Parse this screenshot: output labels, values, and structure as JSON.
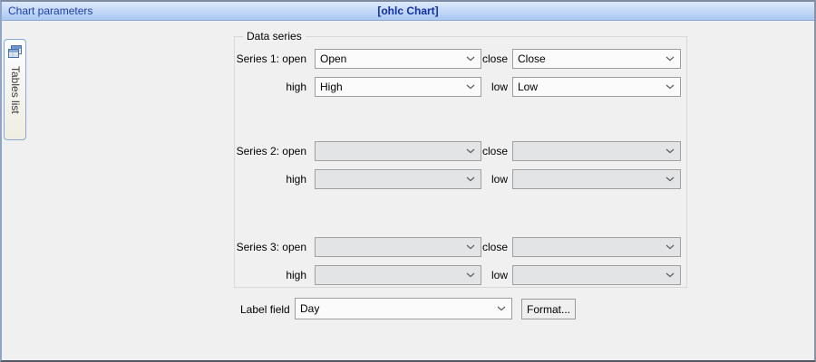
{
  "window": {
    "header": {
      "title_left": "Chart parameters",
      "title_center": "[ohlc Chart]"
    }
  },
  "sidebar": {
    "tab_label": "Tables list",
    "tab_icon": "tables-icon"
  },
  "main": {
    "group_title": "Data series",
    "series": [
      {
        "row_label": "Series 1: open",
        "open_value": "Open",
        "close_label": "close",
        "close_value": "Close",
        "high_label": "high",
        "high_value": "High",
        "low_label": "low",
        "low_value": "Low"
      },
      {
        "row_label": "Series 2: open",
        "open_value": "",
        "close_label": "close",
        "close_value": "",
        "high_label": "high",
        "high_value": "",
        "low_label": "low",
        "low_value": ""
      },
      {
        "row_label": "Series 3: open",
        "open_value": "",
        "close_label": "close",
        "close_value": "",
        "high_label": "high",
        "high_value": "",
        "low_label": "low",
        "low_value": ""
      }
    ],
    "label_field": {
      "label": "Label field",
      "value": "Day",
      "format_button": "Format..."
    }
  },
  "colors": {
    "header_gradient_top": "#dde9fb",
    "header_gradient_bottom": "#aac8f2",
    "header_text": "#1d3fae",
    "panel_bg": "#f0f0f0",
    "combo_filled_bg": "#fbfbfb",
    "combo_empty_bg": "#e3e4e6",
    "tab_border": "#87a9da"
  }
}
